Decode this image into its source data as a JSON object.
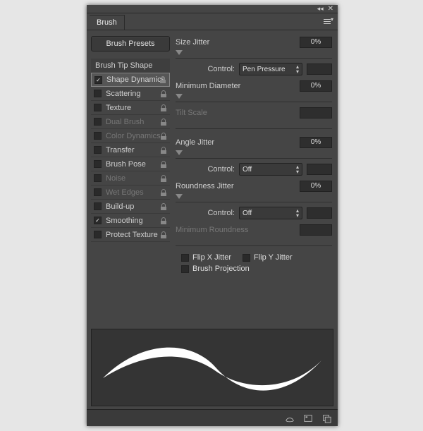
{
  "panel": {
    "title": "Brush"
  },
  "presets_button": "Brush Presets",
  "options": {
    "header": "Brush Tip Shape",
    "rows": [
      {
        "label": "Shape Dynamics",
        "checked": true,
        "enabled": true,
        "lock": true,
        "active": true
      },
      {
        "label": "Scattering",
        "checked": false,
        "enabled": true,
        "lock": true
      },
      {
        "label": "Texture",
        "checked": false,
        "enabled": true,
        "lock": true
      },
      {
        "label": "Dual Brush",
        "checked": false,
        "enabled": false,
        "lock": true
      },
      {
        "label": "Color Dynamics",
        "checked": false,
        "enabled": false,
        "lock": true
      },
      {
        "label": "Transfer",
        "checked": false,
        "enabled": true,
        "lock": true
      },
      {
        "label": "Brush Pose",
        "checked": false,
        "enabled": true,
        "lock": true
      },
      {
        "label": "Noise",
        "checked": false,
        "enabled": false,
        "lock": true
      },
      {
        "label": "Wet Edges",
        "checked": false,
        "enabled": false,
        "lock": true
      },
      {
        "label": "Build-up",
        "checked": false,
        "enabled": true,
        "lock": true
      },
      {
        "label": "Smoothing",
        "checked": true,
        "enabled": true,
        "lock": true
      },
      {
        "label": "Protect Texture",
        "checked": false,
        "enabled": true,
        "lock": true
      }
    ]
  },
  "props": {
    "size_jitter": {
      "label": "Size Jitter",
      "value": "0%"
    },
    "size_control": {
      "label": "Control:",
      "value": "Pen Pressure"
    },
    "min_diam": {
      "label": "Minimum Diameter",
      "value": "0%"
    },
    "tilt_scale": {
      "label": "Tilt Scale"
    },
    "angle_jitter": {
      "label": "Angle Jitter",
      "value": "0%"
    },
    "angle_control": {
      "label": "Control:",
      "value": "Off"
    },
    "round_jitter": {
      "label": "Roundness Jitter",
      "value": "0%"
    },
    "round_control": {
      "label": "Control:",
      "value": "Off"
    },
    "min_round": {
      "label": "Minimum Roundness"
    },
    "flip_x": "Flip X Jitter",
    "flip_y": "Flip Y Jitter",
    "brush_proj": "Brush Projection"
  }
}
